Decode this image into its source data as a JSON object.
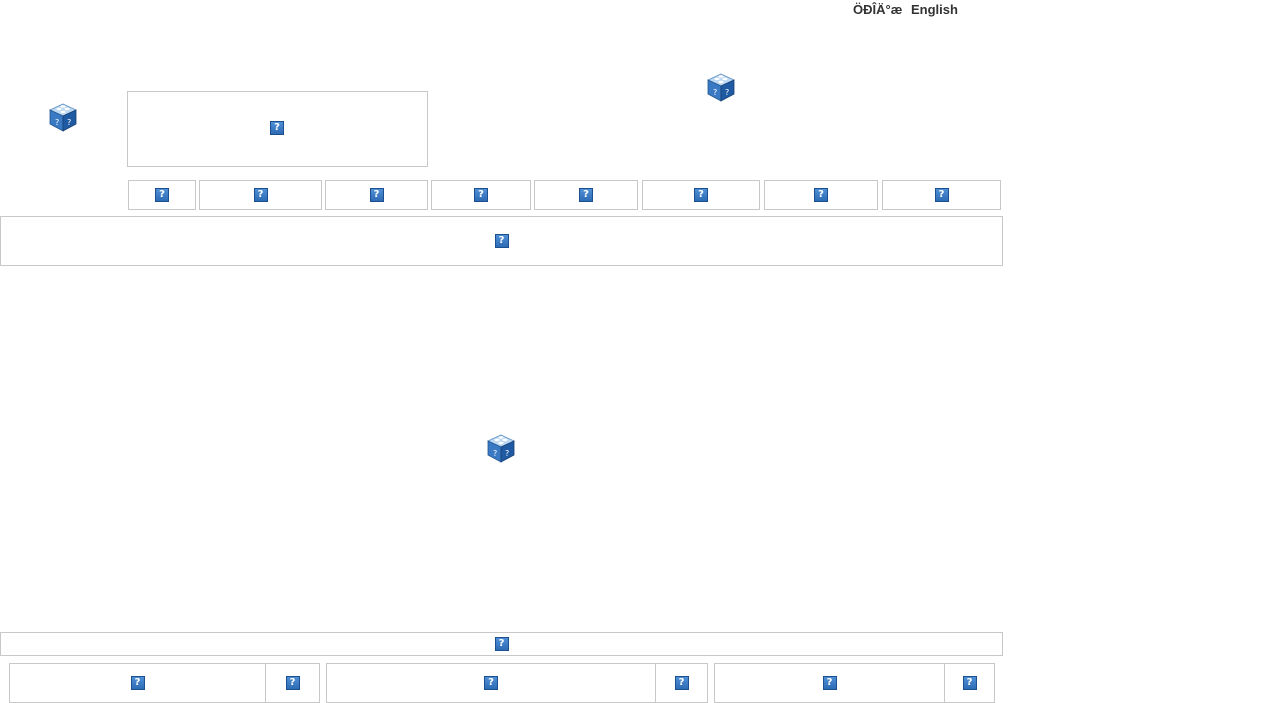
{
  "header": {
    "language_links": [
      "ÖÐÎÄ°æ",
      "English"
    ]
  },
  "icons": {
    "broken_image": "broken-image-placeholder",
    "missing_plugin": "missing-plugin-cube"
  },
  "colors": {
    "border": "#c8c8c8",
    "placeholder_blue": "#2d6bb5",
    "text": "#333333"
  },
  "nav": {
    "item_count": 8
  }
}
